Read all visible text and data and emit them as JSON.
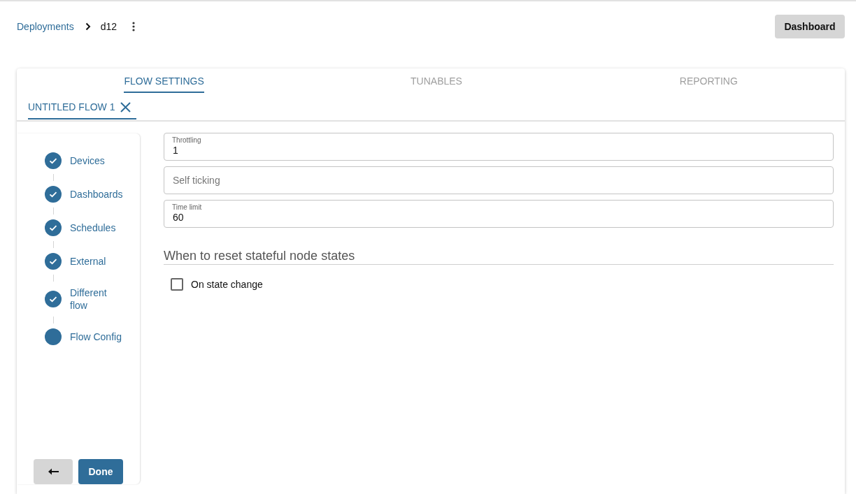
{
  "breadcrumb": [
    {
      "label": "Deployments",
      "kind": "link"
    },
    {
      "label": "d12",
      "kind": "current"
    }
  ],
  "header_button": "Dashboard",
  "tabs": [
    {
      "label": "FLOW SETTINGS",
      "selected": true
    },
    {
      "label": "TUNABLES",
      "selected": false
    },
    {
      "label": "REPORTING",
      "selected": false
    }
  ],
  "flow_tabs": [
    {
      "label": "UNTITLED FLOW 1",
      "selected": true
    }
  ],
  "steps": [
    {
      "label": "Devices",
      "completed": true
    },
    {
      "label": "Dashboards",
      "completed": true
    },
    {
      "label": "Schedules",
      "completed": true
    },
    {
      "label": "External",
      "completed": true
    },
    {
      "label": "Different flow",
      "completed": true
    },
    {
      "label": "Flow Config",
      "completed": false
    }
  ],
  "buttons": [
    {
      "kind": "back"
    },
    {
      "kind": "primary",
      "label": "Done"
    }
  ],
  "fields": [
    {
      "label": "Throttling",
      "value": "1"
    },
    {
      "placeholder": "Self ticking"
    },
    {
      "label": "Time limit",
      "value": "60"
    }
  ],
  "reset_section": {
    "title": "When to reset stateful node states",
    "options": [
      {
        "label": "On state change",
        "checked": false
      }
    ]
  }
}
